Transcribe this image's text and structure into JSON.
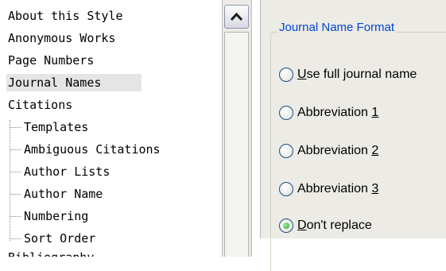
{
  "tree": {
    "items": [
      {
        "label": "About this Style"
      },
      {
        "label": "Anonymous Works"
      },
      {
        "label": "Page Numbers"
      },
      {
        "label": "Journal Names",
        "selected": true
      },
      {
        "label": "Citations"
      }
    ],
    "citation_children": [
      {
        "label": "Templates"
      },
      {
        "label": "Ambiguous Citations"
      },
      {
        "label": "Author Lists"
      },
      {
        "label": "Author Name"
      },
      {
        "label": "Numbering"
      },
      {
        "label": "Sort Order"
      }
    ],
    "partial_item": {
      "label": "Bibliography"
    }
  },
  "scrollbar": {
    "up_icon": "chevron-up-icon"
  },
  "panel": {
    "group_title": "Journal Name Format",
    "options": [
      {
        "accel": "U",
        "rest": "se full journal name",
        "checked": false
      },
      {
        "prefix": "Abbreviation ",
        "accel": "1",
        "checked": false
      },
      {
        "prefix": "Abbreviation ",
        "accel": "2",
        "checked": false
      },
      {
        "prefix": "Abbreviation ",
        "accel": "3",
        "checked": false
      },
      {
        "accel": "D",
        "rest": "on't replace",
        "checked": true
      }
    ]
  },
  "colors": {
    "group_title": "#0046d5",
    "panel_bg": "#ecebe6",
    "selection_bg": "#e5e5e5",
    "radio_checked": "#21a121"
  }
}
